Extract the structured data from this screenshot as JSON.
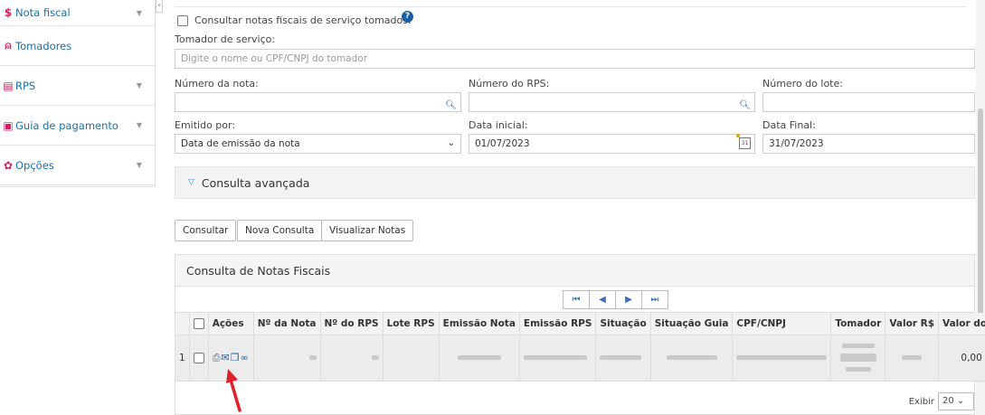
{
  "sidebar": {
    "items": [
      {
        "label": "Nota fiscal",
        "icon": "dollar-icon",
        "has_chevron": true
      },
      {
        "label": "Tomadores",
        "icon": "user-icon",
        "has_chevron": false
      },
      {
        "label": "RPS",
        "icon": "list-icon",
        "has_chevron": true
      },
      {
        "label": "Guia de pagamento",
        "icon": "payment-icon",
        "has_chevron": true
      },
      {
        "label": "Opções",
        "icon": "gear-icon",
        "has_chevron": true
      }
    ]
  },
  "form": {
    "consult_tomados_label": "Consultar notas fiscais de serviço tomados.",
    "tomador_label": "Tomador de serviço:",
    "tomador_placeholder": "Digite o nome ou CPF/CNPJ do tomador",
    "numero_nota_label": "Número da nota:",
    "numero_rps_label": "Número do RPS:",
    "numero_lote_label": "Número do lote:",
    "emitido_por_label": "Emitido por:",
    "emitido_por_value": "Data de emissão da nota",
    "data_inicial_label": "Data inicial:",
    "data_inicial_value": "01/07/2023",
    "data_final_label": "Data Final:",
    "data_final_value": "31/07/2023"
  },
  "advanced": {
    "label": "Consulta avançada"
  },
  "buttons": {
    "consultar": "Consultar",
    "nova_consulta": "Nova Consulta",
    "visualizar_notas": "Visualizar Notas"
  },
  "results": {
    "title": "Consulta de Notas Fiscais",
    "pager": [
      "⏮",
      "◀",
      "▶",
      "⏭"
    ],
    "columns": [
      "Ações",
      "Nº da Nota",
      "Nº do RPS",
      "Lote RPS",
      "Emissão Nota",
      "Emissão RPS",
      "Situação",
      "Situação Guia",
      "CPF/CNPJ",
      "Tomador",
      "Valor R$",
      "Valor do IS"
    ],
    "rows": [
      {
        "index": "1",
        "valor_iss": "0,00"
      }
    ],
    "footer_label": "Exibir",
    "page_size": "20"
  },
  "colors": {
    "sidebar_icon": "#d81b60",
    "sidebar_link": "#1b6fa8",
    "help_icon": "#1d5fa6",
    "arrow": "#e0202a"
  }
}
